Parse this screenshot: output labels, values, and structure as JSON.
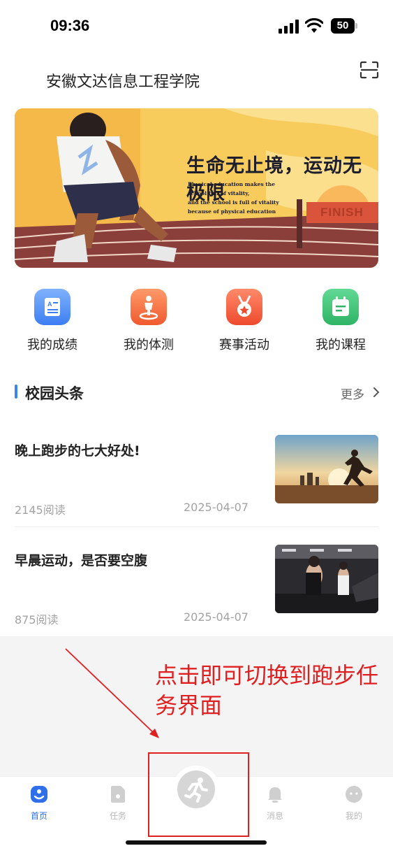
{
  "status_bar": {
    "time": "09:36",
    "battery": "50",
    "icons": [
      "signal-icon",
      "wifi-icon",
      "battery-icon"
    ]
  },
  "header": {
    "school_name": "安徽文达信息工程学院",
    "scan_icon": "scan-icon"
  },
  "banner": {
    "headline": "生命无止境，运动无极限",
    "subtitle_lines": [
      "Physical education makes the",
      "school full of vitality,",
      "and the school is full of vitality",
      "because of physical education"
    ],
    "finish_sign": "FINISH"
  },
  "quick_menu": [
    {
      "label": "我的成绩",
      "icon": "report-card-icon",
      "color": "#4f8ff7"
    },
    {
      "label": "我的体测",
      "icon": "fitness-test-icon",
      "color": "#f26a3c"
    },
    {
      "label": "赛事活动",
      "icon": "medal-icon",
      "color": "#f25c3c"
    },
    {
      "label": "我的课程",
      "icon": "calendar-icon",
      "color": "#3ec47a"
    }
  ],
  "news_section": {
    "title": "校园头条",
    "more": "更多"
  },
  "news": [
    {
      "title": "晚上跑步的七大好处!",
      "reads": "2145阅读",
      "date": "2025-04-07"
    },
    {
      "title": "早晨运动，是否要空腹",
      "reads": "875阅读",
      "date": "2025-04-07"
    }
  ],
  "annotation": {
    "text": "点击即可切换到跑步任务界面",
    "color": "#e02020"
  },
  "tab_bar": {
    "tabs": [
      {
        "label": "首页",
        "icon": "home-icon",
        "active": true
      },
      {
        "label": "任务",
        "icon": "task-icon",
        "active": false
      },
      {
        "label": "消息",
        "icon": "bell-icon",
        "active": false
      },
      {
        "label": "我的",
        "icon": "profile-icon",
        "active": false
      }
    ],
    "center_button_icon": "running-icon",
    "active_color": "#2f6fea"
  }
}
